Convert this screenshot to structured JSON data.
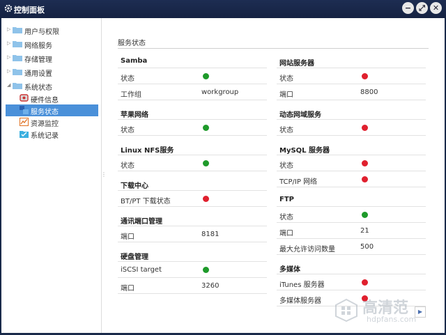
{
  "window": {
    "title": "控制面板"
  },
  "sidebar": {
    "items": [
      {
        "label": "用户与权限"
      },
      {
        "label": "网络服务"
      },
      {
        "label": "存储管理"
      },
      {
        "label": "通用设置"
      },
      {
        "label": "系统状态"
      }
    ],
    "children": [
      {
        "label": "硬件信息",
        "icon": "hardware-icon"
      },
      {
        "label": "服务状态",
        "icon": "services-icon",
        "selected": true
      },
      {
        "label": "资源监控",
        "icon": "monitor-icon"
      },
      {
        "label": "系统记录",
        "icon": "log-icon"
      }
    ]
  },
  "main": {
    "section_title": "服务状态",
    "left": [
      {
        "name": "Samba",
        "rows": [
          {
            "k": "状态",
            "status": "green"
          },
          {
            "k": "工作组",
            "v": "workgroup"
          }
        ]
      },
      {
        "name": "苹果网络",
        "rows": [
          {
            "k": "状态",
            "status": "green"
          }
        ]
      },
      {
        "name": "Linux NFS服务",
        "rows": [
          {
            "k": "状态",
            "status": "green"
          }
        ]
      },
      {
        "name": "下载中心",
        "rows": [
          {
            "k": "BT/PT 下载状态",
            "status": "red"
          }
        ]
      },
      {
        "name": "通讯端口管理",
        "rows": [
          {
            "k": "端口",
            "v": "8181"
          }
        ]
      },
      {
        "name": "硬盘管理",
        "rows": [
          {
            "k": "iSCSI target",
            "status": "green"
          },
          {
            "k": "端口",
            "v": "3260"
          }
        ]
      }
    ],
    "right": [
      {
        "name": "网站服务器",
        "rows": [
          {
            "k": "状态",
            "status": "red"
          },
          {
            "k": "端口",
            "v": "8800"
          }
        ]
      },
      {
        "name": "动态网域服务",
        "rows": [
          {
            "k": "状态",
            "status": "red"
          }
        ]
      },
      {
        "name": "MySQL 服务器",
        "rows": [
          {
            "k": "状态",
            "status": "red"
          },
          {
            "k": "TCP/IP 网络",
            "status": "red"
          }
        ]
      },
      {
        "name": "FTP",
        "rows": [
          {
            "k": "状态",
            "status": "green"
          },
          {
            "k": "端口",
            "v": "21"
          },
          {
            "k": "最大允许访问数量",
            "v": "500"
          }
        ]
      },
      {
        "name": "多媒体",
        "rows": [
          {
            "k": "iTunes 服务器",
            "status": "red"
          },
          {
            "k": "多媒体服务器",
            "status": "red"
          }
        ]
      }
    ]
  },
  "watermark": {
    "line1": "高清范",
    "line2": "hdpfans.com"
  },
  "colors": {
    "green": "#1e9a2a",
    "red": "#e0202e",
    "titlebar": "#1d2d52",
    "selected": "#4a90d9"
  }
}
